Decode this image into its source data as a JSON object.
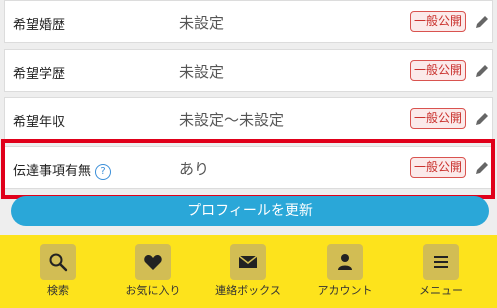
{
  "profile_rows": [
    {
      "label": "希望婚歴",
      "value": "未設定",
      "badge": "一般公開"
    },
    {
      "label": "希望学歴",
      "value": "未設定",
      "badge": "一般公開"
    },
    {
      "label": "希望年収",
      "value": "未設定〜未設定",
      "badge": "一般公開"
    },
    {
      "label": "伝達事項有無",
      "value": "あり",
      "badge": "一般公開",
      "help": "?"
    }
  ],
  "update_button": {
    "label": "プロフィールを更新"
  },
  "tabbar": {
    "items": [
      {
        "label": "検索",
        "icon": "search-icon"
      },
      {
        "label": "お気に入り",
        "icon": "heart-icon"
      },
      {
        "label": "連絡ボックス",
        "icon": "mail-icon"
      },
      {
        "label": "アカウント",
        "icon": "user-icon"
      },
      {
        "label": "メニュー",
        "icon": "menu-icon"
      }
    ]
  },
  "colors": {
    "tabbar_bg": "#fde31c",
    "update_button": "#2aa7d8",
    "badge_border": "#d9534f",
    "highlight": "#e0001a"
  }
}
